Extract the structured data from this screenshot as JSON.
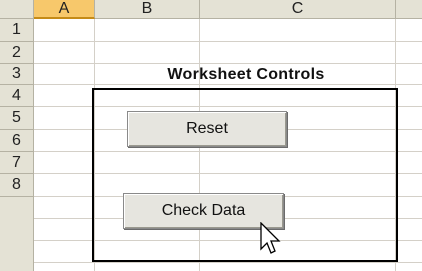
{
  "columns": [
    {
      "label": "A",
      "selected": true
    },
    {
      "label": "B",
      "selected": false
    },
    {
      "label": "C",
      "selected": false
    }
  ],
  "rows": [
    "1",
    "2",
    "3",
    "4",
    "5",
    "6",
    "7",
    "8"
  ],
  "title": "Worksheet Controls",
  "buttons": {
    "reset_label": "Reset",
    "check_data_label": "Check Data"
  },
  "colors": {
    "header_bg": "#e4e2d5",
    "selected_header_bg": "#f7c86b",
    "grid_line": "#d4d0c8",
    "frame_border": "#000000",
    "button_face": "#e6e5df"
  },
  "icons": {
    "cursor": "mouse-pointer-icon"
  }
}
